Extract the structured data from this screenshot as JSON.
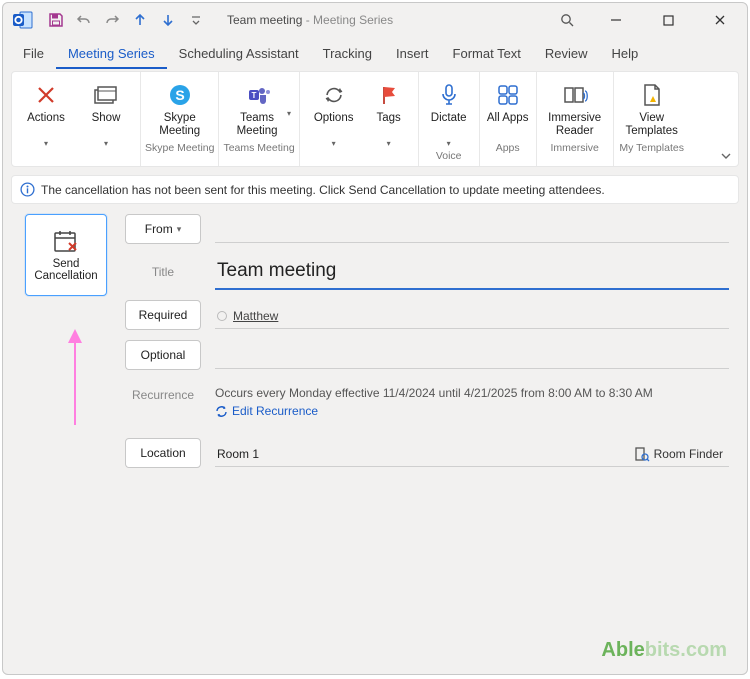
{
  "window": {
    "title_main": "Team meeting",
    "title_sep": "  -  ",
    "title_sub": "Meeting Series"
  },
  "tabs": {
    "file": "File",
    "meeting_series": "Meeting Series",
    "scheduling": "Scheduling Assistant",
    "tracking": "Tracking",
    "insert": "Insert",
    "format": "Format Text",
    "review": "Review",
    "help": "Help"
  },
  "ribbon": {
    "actions": "Actions",
    "show": "Show",
    "skype": "Skype Meeting",
    "skype_group": "Skype Meeting",
    "teams": "Teams Meeting",
    "teams_group": "Teams Meeting",
    "options": "Options",
    "tags": "Tags",
    "dictate": "Dictate",
    "voice_group": "Voice",
    "allapps": "All Apps",
    "apps_group": "Apps",
    "immersive": "Immersive Reader",
    "immersive_group": "Immersive",
    "templates": "View Templates",
    "templates_group": "My Templates"
  },
  "infobar": "The cancellation has not been sent for this meeting. Click Send Cancellation to update meeting attendees.",
  "form": {
    "send_cancel_l1": "Send",
    "send_cancel_l2": "Cancellation",
    "from": "From",
    "title_label": "Title",
    "title_value": "Team meeting",
    "required": "Required",
    "attendee": "Matthew",
    "optional": "Optional",
    "recurrence_label": "Recurrence",
    "recurrence_value": "Occurs every Monday effective 11/4/2024 until 4/21/2025 from 8:00 AM to 8:30 AM",
    "edit_recurrence": "Edit Recurrence",
    "location": "Location",
    "location_value": "Room 1",
    "room_finder": "Room Finder"
  },
  "watermark": {
    "a": "Able",
    "b": "bits.com"
  }
}
